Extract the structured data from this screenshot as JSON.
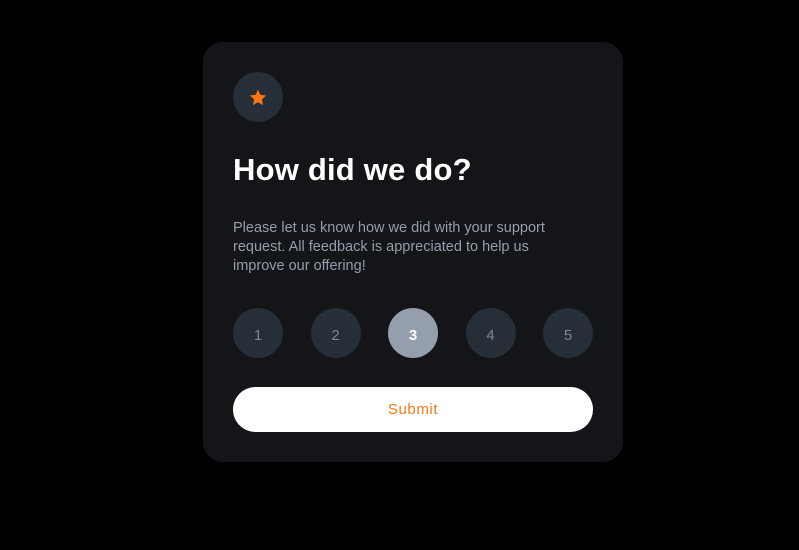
{
  "card": {
    "icon": "star-icon",
    "title": "How did we do?",
    "description": "Please let us know how we did with your support request. All feedback is appreciated to help us improve our offering!",
    "ratings": [
      "1",
      "2",
      "3",
      "4",
      "5"
    ],
    "selected_rating": "3",
    "submit_label": "Submit"
  },
  "colors": {
    "background": "#000000",
    "card": "#131518",
    "badge": "#262e38",
    "accent": "#fc7614",
    "muted_text": "#959eac",
    "selected": "#959eac"
  }
}
